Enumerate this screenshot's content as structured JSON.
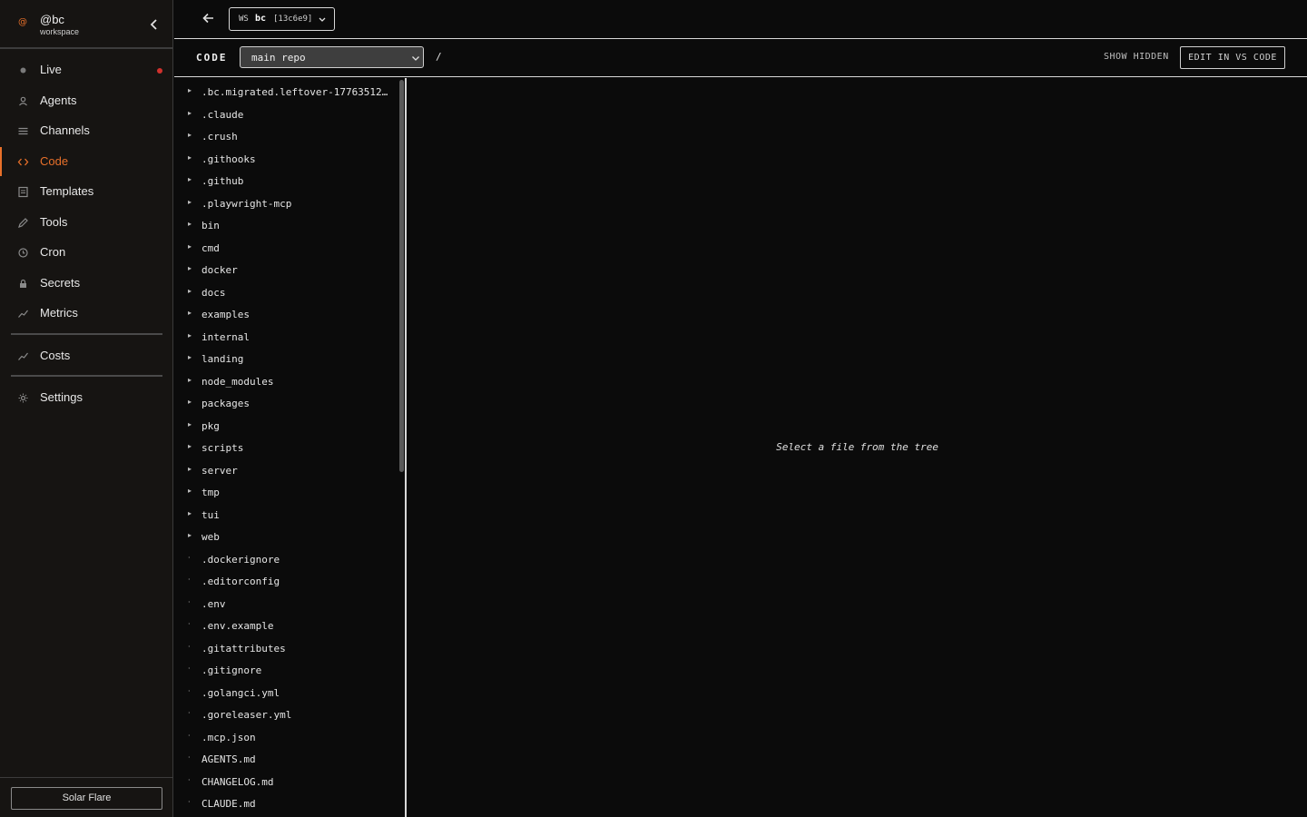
{
  "sidebar": {
    "logo_glyph": "@",
    "workspace_name": "@bc",
    "workspace_sub": "workspace",
    "items": [
      {
        "label": "Live",
        "icon": "live-dot-icon"
      },
      {
        "label": "Agents",
        "icon": "person-icon"
      },
      {
        "label": "Channels",
        "icon": "lines-icon"
      },
      {
        "label": "Code",
        "icon": "code-brackets-icon"
      },
      {
        "label": "Templates",
        "icon": "document-icon"
      },
      {
        "label": "Tools",
        "icon": "pencil-icon"
      },
      {
        "label": "Cron",
        "icon": "clock-icon"
      },
      {
        "label": "Secrets",
        "icon": "lock-icon"
      },
      {
        "label": "Metrics",
        "icon": "trend-icon"
      },
      {
        "label": "Costs",
        "icon": "trend-icon"
      },
      {
        "label": "Settings",
        "icon": "gear-icon"
      }
    ],
    "active": "Code",
    "theme_button": "Solar Flare"
  },
  "topbar": {
    "ws_prefix": "WS",
    "ws_name": "bc",
    "ws_hash": "[13c6e9]"
  },
  "codebar": {
    "title": "CODE",
    "repo_value": "main repo",
    "path": "/",
    "show_hidden": "SHOW HIDDEN",
    "edit_vscode": "EDIT IN VS CODE"
  },
  "tree": {
    "folder_marker": "▸",
    "file_marker": "·",
    "entries": [
      {
        "name": ".bc.migrated.leftover-17763512…",
        "type": "folder"
      },
      {
        "name": ".claude",
        "type": "folder"
      },
      {
        "name": ".crush",
        "type": "folder"
      },
      {
        "name": ".githooks",
        "type": "folder"
      },
      {
        "name": ".github",
        "type": "folder"
      },
      {
        "name": ".playwright-mcp",
        "type": "folder"
      },
      {
        "name": "bin",
        "type": "folder"
      },
      {
        "name": "cmd",
        "type": "folder"
      },
      {
        "name": "docker",
        "type": "folder"
      },
      {
        "name": "docs",
        "type": "folder"
      },
      {
        "name": "examples",
        "type": "folder"
      },
      {
        "name": "internal",
        "type": "folder"
      },
      {
        "name": "landing",
        "type": "folder"
      },
      {
        "name": "node_modules",
        "type": "folder"
      },
      {
        "name": "packages",
        "type": "folder"
      },
      {
        "name": "pkg",
        "type": "folder"
      },
      {
        "name": "scripts",
        "type": "folder"
      },
      {
        "name": "server",
        "type": "folder"
      },
      {
        "name": "tmp",
        "type": "folder"
      },
      {
        "name": "tui",
        "type": "folder"
      },
      {
        "name": "web",
        "type": "folder"
      },
      {
        "name": ".dockerignore",
        "type": "file"
      },
      {
        "name": ".editorconfig",
        "type": "file"
      },
      {
        "name": ".env",
        "type": "file"
      },
      {
        "name": ".env.example",
        "type": "file"
      },
      {
        "name": ".gitattributes",
        "type": "file"
      },
      {
        "name": ".gitignore",
        "type": "file"
      },
      {
        "name": ".golangci.yml",
        "type": "file"
      },
      {
        "name": ".goreleaser.yml",
        "type": "file"
      },
      {
        "name": ".mcp.json",
        "type": "file"
      },
      {
        "name": "AGENTS.md",
        "type": "file"
      },
      {
        "name": "CHANGELOG.md",
        "type": "file"
      },
      {
        "name": "CLAUDE.md",
        "type": "file"
      }
    ]
  },
  "content": {
    "empty_message": "Select a file from the tree"
  },
  "colors": {
    "accent": "#e8702a",
    "live_indicator": "#d0312d",
    "background": "#0b0b0b",
    "sidebar_bg": "#161412"
  }
}
